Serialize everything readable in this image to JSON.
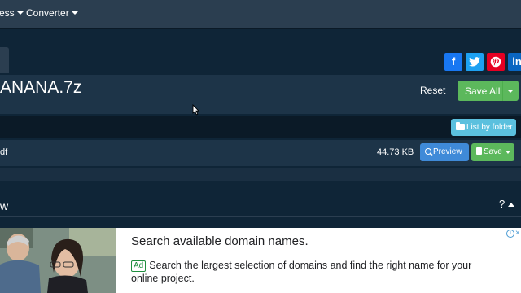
{
  "nav": {
    "items": [
      {
        "label": "ess"
      },
      {
        "label": "Converter"
      }
    ]
  },
  "share": {
    "facebook_glyph": "f",
    "twitter_glyph": "t",
    "pinterest_glyph": "p",
    "linkedin_glyph": "in"
  },
  "header": {
    "title": "ANANA.7z",
    "reset_label": "Reset",
    "save_all_label": "Save All"
  },
  "toolbar": {
    "list_by_folder_label": "List by folder"
  },
  "files": [
    {
      "name": "df",
      "size": "44.73 KB",
      "preview_label": "Preview",
      "save_label": "Save"
    }
  ],
  "section": {
    "title": "w",
    "help_glyph": "?"
  },
  "ad": {
    "headline": "Search available domain names.",
    "badge": "Ad",
    "description": "Search the largest selection of domains and find the right name for your online project.",
    "close_glyph": "×",
    "info_glyph": "i"
  },
  "colors": {
    "page_bg": "#0f2537",
    "nav_bg": "#2b3e50",
    "panel_bg": "#1d3448",
    "success": "#5cb85c",
    "info": "#5bc0de",
    "primary": "#3f8ad8",
    "facebook": "#1877f2",
    "twitter": "#1da1f2",
    "pinterest": "#e60023",
    "linkedin": "#0a66c2"
  },
  "icons": [
    "facebook-icon",
    "twitter-icon",
    "pinterest-icon",
    "linkedin-icon",
    "folder-open-icon",
    "search-icon",
    "file-icon",
    "chevron-down-icon",
    "help-icon",
    "chevron-up-icon",
    "ad-info-icon",
    "close-icon",
    "mouse-cursor-icon"
  ]
}
